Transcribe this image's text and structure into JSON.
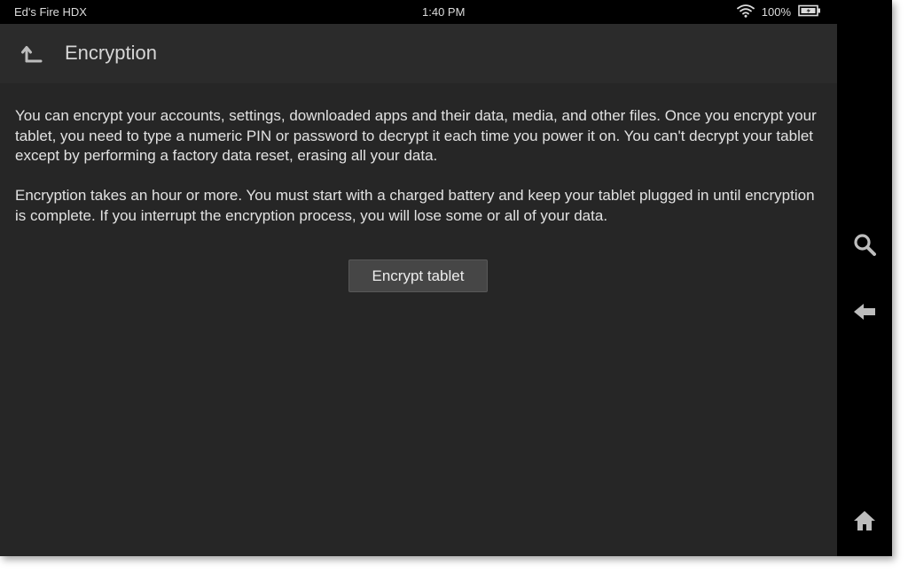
{
  "status_bar": {
    "device_name": "Ed's Fire HDX",
    "time": "1:40 PM",
    "battery_percent": "100%",
    "icons": [
      "wifi-icon",
      "battery-icon"
    ]
  },
  "header": {
    "title": "Encryption",
    "icon": "up-arrow-icon"
  },
  "content": {
    "paragraph_1": "You can encrypt your accounts, settings, downloaded apps and their data, media, and other files. Once you encrypt your tablet, you need to type a numeric PIN or password to decrypt it each time you power it on. You can't decrypt your tablet except by performing a factory data reset, erasing all your data.",
    "paragraph_2": "Encryption takes an hour or more. You must start with a charged battery and keep your tablet plugged in until encryption is complete. If you interrupt the encryption process, you will lose some or all of your data.",
    "button_label": "Encrypt tablet"
  },
  "nav_bar": {
    "icons": [
      "search-icon",
      "back-arrow-icon",
      "home-icon"
    ]
  },
  "colors": {
    "background": "#262626",
    "header_background": "#2b2b2b",
    "status_bar": "#000000",
    "button": "#464646",
    "text": "#e2e2e2"
  }
}
